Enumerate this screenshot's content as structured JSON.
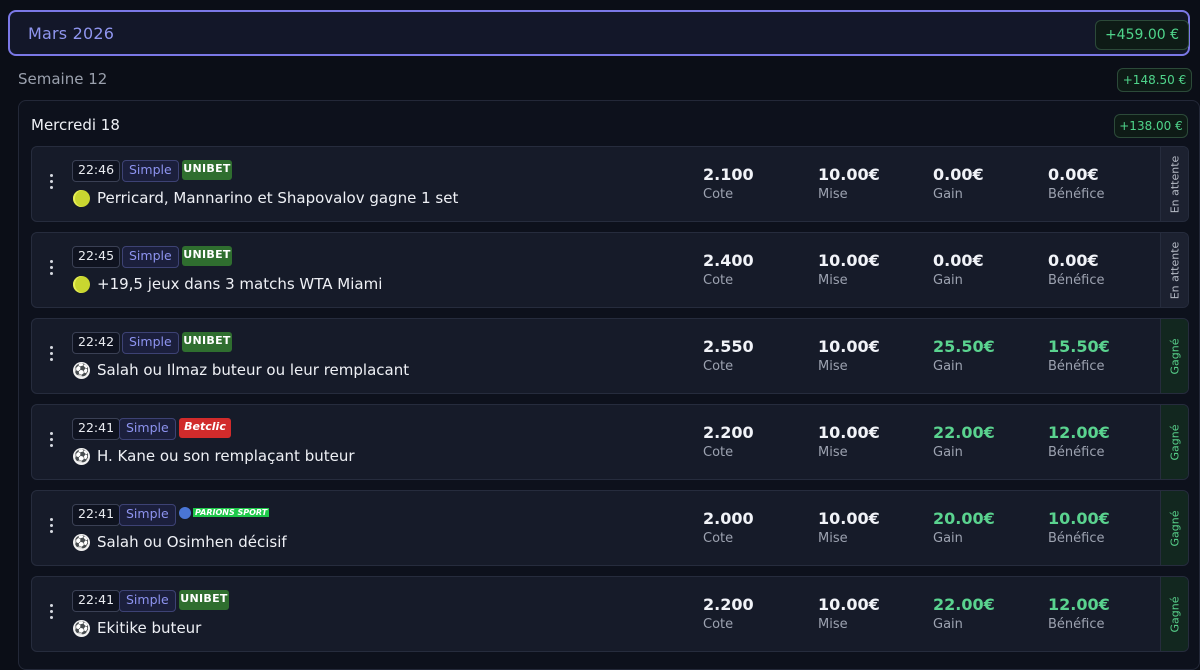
{
  "month": {
    "title": "Mars 2026",
    "total": "+459.00 €"
  },
  "week": {
    "label": "Semaine 12",
    "total": "+148.50 €"
  },
  "day": {
    "label": "Mercredi 18",
    "total": "+138.00 €"
  },
  "colors": {
    "accent": "#7b78e6",
    "win": "#4fd58b"
  },
  "labels": {
    "cote": "Cote",
    "mise": "Mise",
    "gain": "Gain",
    "benefice": "Bénéfice"
  },
  "bets": [
    {
      "time": "22:46",
      "type": "Simple",
      "bookmaker": "UNIBET",
      "sport_icon": "tennis-ball-icon",
      "title": "Perricard, Mannarino et Shapovalov gagne 1 set",
      "cote": "2.100",
      "mise": "10.00€",
      "gain": "0.00€",
      "benefice": "0.00€",
      "status": "En attente"
    },
    {
      "time": "22:45",
      "type": "Simple",
      "bookmaker": "UNIBET",
      "sport_icon": "tennis-ball-icon",
      "title": "+19,5 jeux dans 3 matchs WTA Miami",
      "cote": "2.400",
      "mise": "10.00€",
      "gain": "0.00€",
      "benefice": "0.00€",
      "status": "En attente"
    },
    {
      "time": "22:42",
      "type": "Simple",
      "bookmaker": "UNIBET",
      "sport_icon": "soccer-ball-icon",
      "title": "Salah ou Ilmaz buteur ou leur remplacant",
      "cote": "2.550",
      "mise": "10.00€",
      "gain": "25.50€",
      "benefice": "15.50€",
      "status": "Gagné"
    },
    {
      "time": "22:41",
      "type": "Simple",
      "bookmaker": "Betclic",
      "sport_icon": "soccer-ball-icon",
      "title": "H. Kane ou son remplaçant buteur",
      "cote": "2.200",
      "mise": "10.00€",
      "gain": "22.00€",
      "benefice": "12.00€",
      "status": "Gagné"
    },
    {
      "time": "22:41",
      "type": "Simple",
      "bookmaker": "PARIONS SPORT",
      "sport_icon": "soccer-ball-icon",
      "title": "Salah ou Osimhen décisif",
      "cote": "2.000",
      "mise": "10.00€",
      "gain": "20.00€",
      "benefice": "10.00€",
      "status": "Gagné"
    },
    {
      "time": "22:41",
      "type": "Simple",
      "bookmaker": "UNIBET",
      "sport_icon": "soccer-ball-icon",
      "title": "Ekitike buteur",
      "cote": "2.200",
      "mise": "10.00€",
      "gain": "22.00€",
      "benefice": "12.00€",
      "status": "Gagné"
    }
  ]
}
